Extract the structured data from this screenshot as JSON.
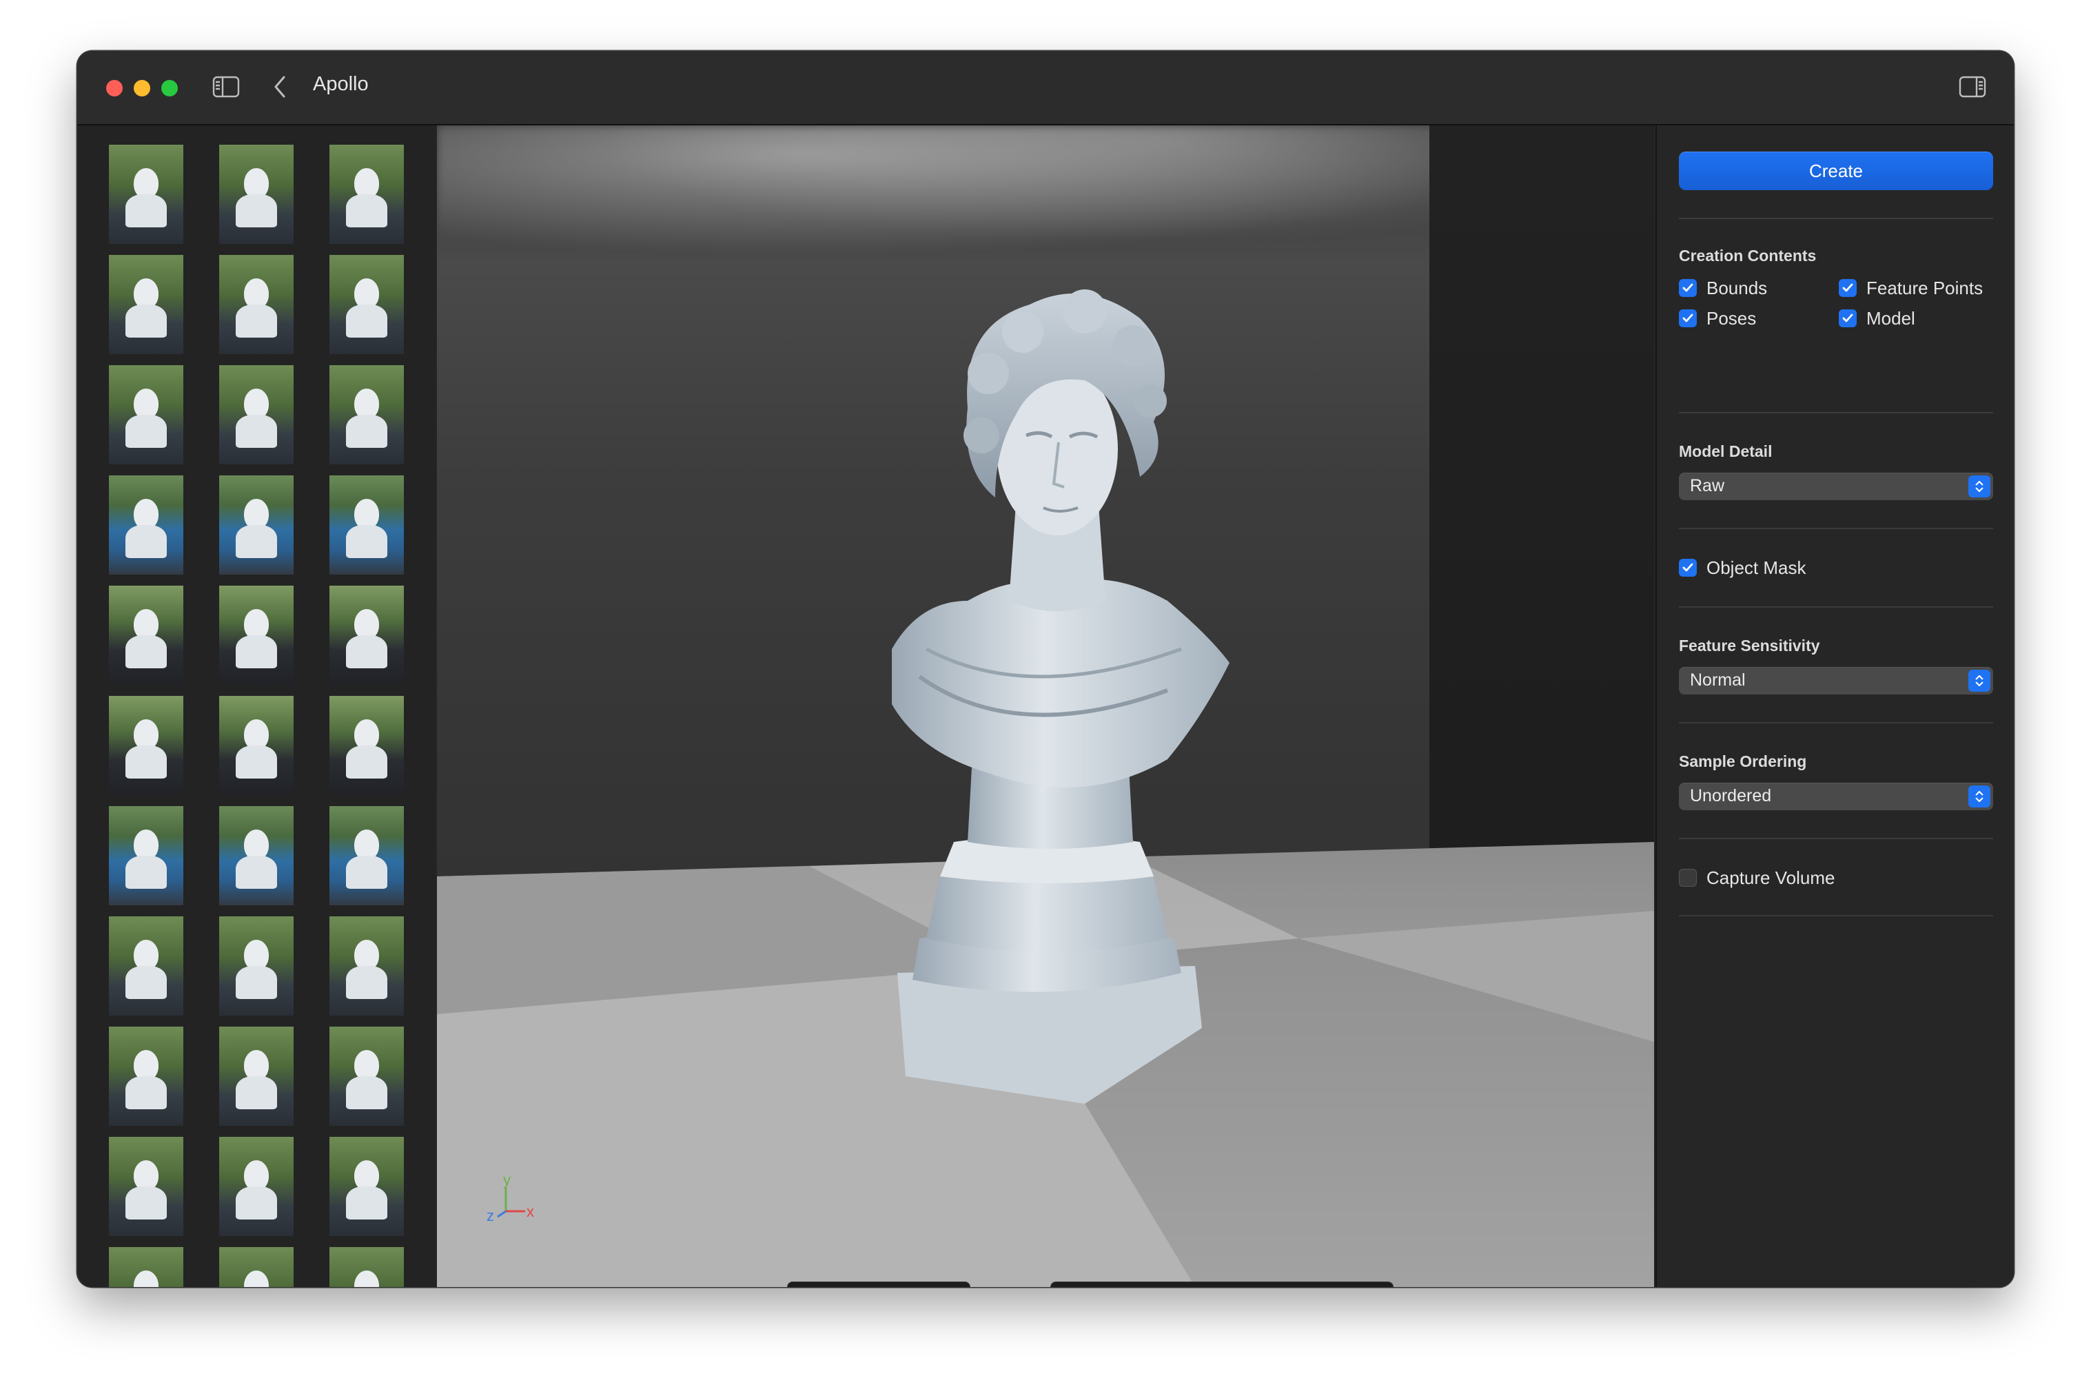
{
  "window": {
    "title": "Apollo"
  },
  "thumbnails": {
    "rows": 11,
    "columns": 3
  },
  "inspector": {
    "create_label": "Create",
    "creation_contents": {
      "label": "Creation Contents",
      "options": [
        {
          "label": "Bounds",
          "checked": true
        },
        {
          "label": "Feature Points",
          "checked": true
        },
        {
          "label": "Poses",
          "checked": true
        },
        {
          "label": "Model",
          "checked": true
        }
      ]
    },
    "model_detail": {
      "label": "Model Detail",
      "value": "Raw"
    },
    "object_mask": {
      "label": "Object Mask",
      "checked": true
    },
    "feature_sensitivity": {
      "label": "Feature Sensitivity",
      "value": "Normal"
    },
    "sample_ordering": {
      "label": "Sample Ordering",
      "value": "Unordered"
    },
    "capture_volume": {
      "label": "Capture Volume",
      "checked": false
    }
  },
  "viewport": {
    "axis_labels": {
      "x": "x",
      "y": "y",
      "z": "z"
    },
    "toolbar_icons": [
      "snapshot-icon",
      "portrait-icon",
      "circle-mask-icon",
      "layers-icon",
      "grid-icon",
      "contrast-icon",
      "light-icon",
      "frame-icon",
      "cube-icon",
      "graph-icon",
      "points-icon",
      "model-icon"
    ],
    "active_tool": "model-icon"
  },
  "colors": {
    "accent": "#1f72f2",
    "close": "#ff5f57",
    "minimize": "#febc2e",
    "maximize": "#28c840"
  }
}
